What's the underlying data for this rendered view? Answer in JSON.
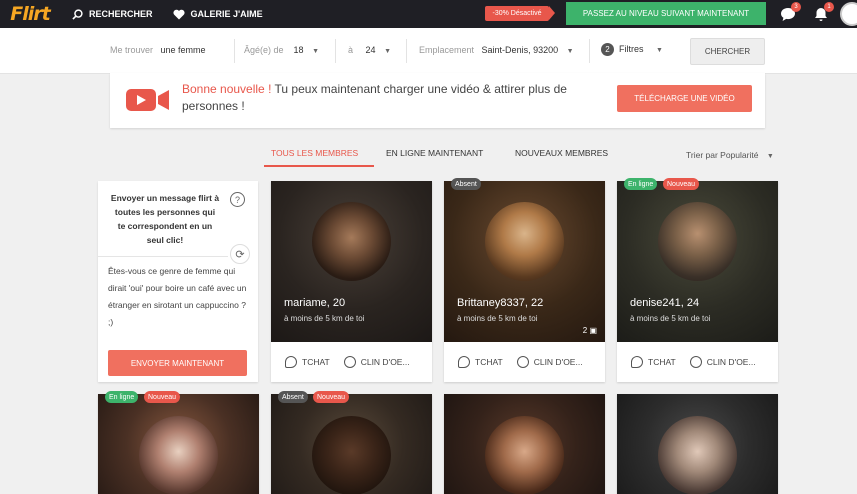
{
  "topbar": {
    "logo": "Flirt",
    "nav": [
      {
        "label": "RECHERCHER",
        "icon": "search-icon"
      },
      {
        "label": "GALERIE J'AIME",
        "icon": "heart-icon"
      }
    ],
    "promo_badge": "-30% Désactivé",
    "upgrade_label": "PASSEZ AU NIVEAU SUIVANT MAINTENANT",
    "messages_count": "3",
    "notifications_count": "1"
  },
  "search": {
    "me_label": "Me trouver",
    "me_value": "une femme",
    "age_label": "Âgé(e) de",
    "age_from": "18",
    "age_to_label": "à",
    "age_to": "24",
    "location_label": "Emplacement",
    "location_value": "Saint-Denis, 93200",
    "filters_count": "2",
    "filters_label": "Filtres",
    "search_button": "CHERCHER"
  },
  "banner": {
    "highlight": "Bonne nouvelle !",
    "text": " Tu peux maintenant charger une vidéo & attirer plus de personnes !",
    "button": "TÉLÉCHARGE UNE VIDÉO"
  },
  "tabs": [
    "TOUS LES MEMBRES",
    "EN LIGNE MAINTENANT",
    "NOUVEAUX MEMBRES"
  ],
  "sort_label": "Trier par Popularité",
  "flirt": {
    "title": "Envoyer un message flirt à toutes les personnes qui te correspondent en un seul clic!",
    "message": "Êtes-vous ce genre de femme qui dirait 'oui' pour boire un café avec un étranger en sirotant un cappuccino ? ;)",
    "button": "ENVOYER MAINTENANT"
  },
  "members": [
    {
      "name": "mariame, 20",
      "distance": "à moins de 5 km de toi",
      "badges": [],
      "photos": ""
    },
    {
      "name": "Brittaney8337, 22",
      "distance": "à moins de 5 km de toi",
      "badges": [
        "Absent"
      ],
      "photos": "2"
    },
    {
      "name": "denise241, 24",
      "distance": "à moins de 5 km de toi",
      "badges": [
        "En ligne",
        "Nouveau"
      ],
      "photos": ""
    }
  ],
  "members_row2": [
    {
      "badges": [
        "En ligne",
        "Nouveau"
      ]
    },
    {
      "badges": [
        "Absent",
        "Nouveau"
      ]
    },
    {
      "badges": []
    },
    {
      "badges": []
    }
  ],
  "actions": {
    "chat": "TCHAT",
    "wink": "CLIN D'OE..."
  },
  "colors": {
    "accent": "#e8574b",
    "online": "#3db36b",
    "topbar": "#1f1f25"
  }
}
